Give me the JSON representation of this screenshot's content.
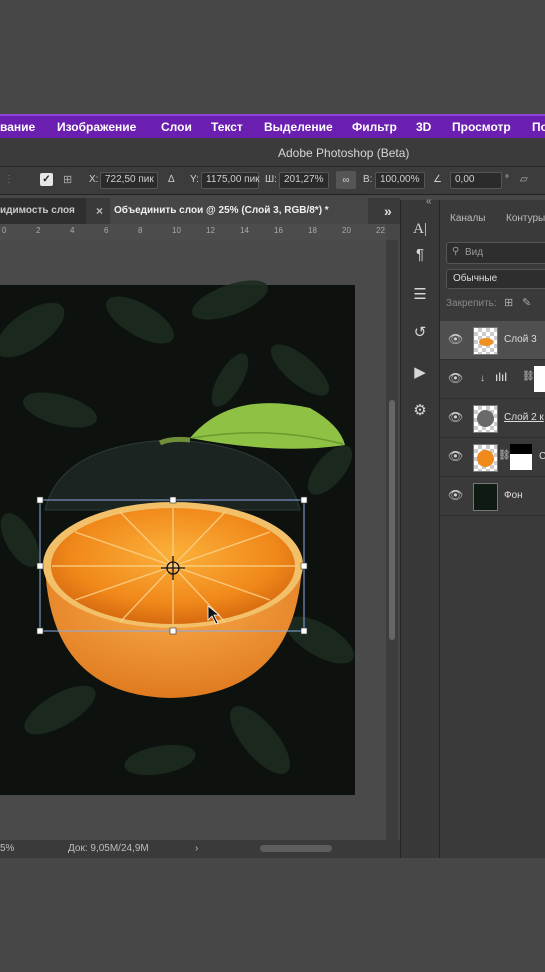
{
  "menu": {
    "items": [
      "вание",
      "Изображение",
      "Слои",
      "Текст",
      "Выделение",
      "Фильтр",
      "3D",
      "Просмотр",
      "По"
    ]
  },
  "window": {
    "title": "Adobe Photoshop (Beta)"
  },
  "options": {
    "x_label": "X:",
    "x_value": "722,50 пик",
    "delta_icon": "Δ",
    "y_label": "Y:",
    "y_value": "1175,00 пик",
    "w_label": "Ш:",
    "w_value": "201,27%",
    "link_icon": "∞",
    "h_label": "В:",
    "h_value": "100,00%",
    "angle_icon": "∠",
    "angle_value": "0,00",
    "degree": "°"
  },
  "tabs": {
    "prev": "идимость слоя",
    "active": "Объединить слои @ 25% (Слой 3, RGB/8*) *",
    "close": "×",
    "more": "»"
  },
  "ruler": [
    "0",
    "2",
    "4",
    "6",
    "8",
    "10",
    "12",
    "14",
    "16",
    "18",
    "20",
    "22"
  ],
  "status": {
    "zoom": "5%",
    "doc": "Док: 9,05M/24,9M",
    "arrow": "›"
  },
  "panel": {
    "collapse": "«",
    "tab_channels": "Каналы",
    "tab_paths": "Контуры",
    "search_placeholder": "Вид",
    "blend_mode": "Обычные",
    "lock_label": "Закрепить:",
    "layers": [
      {
        "name": "Слой 3",
        "visible": true,
        "selected": true
      },
      {
        "name": "",
        "visible": true,
        "selected": false
      },
      {
        "name": "Слой 2 к",
        "visible": true,
        "selected": false
      },
      {
        "name": "С",
        "visible": true,
        "selected": false
      },
      {
        "name": "Фон",
        "visible": true,
        "selected": false
      }
    ]
  },
  "colors": {
    "menubar": "#6a1fb0",
    "ui_dark": "#3a3a3a",
    "orange": "#f08a1a"
  }
}
